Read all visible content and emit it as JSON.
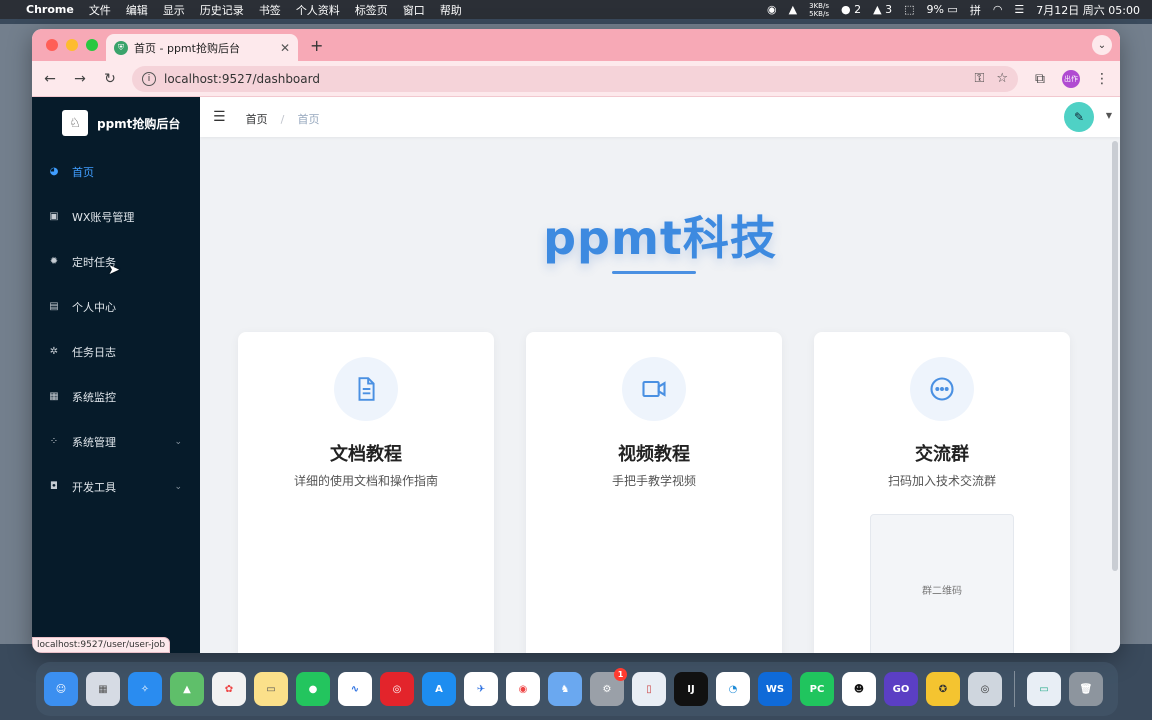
{
  "menubar": {
    "app_name": "Chrome",
    "items": [
      "文件",
      "编辑",
      "显示",
      "历史记录",
      "书签",
      "个人资料",
      "标签页",
      "窗口",
      "帮助"
    ],
    "net_up": "3KB/s",
    "net_down": "5KB/s",
    "wechat_count": "2",
    "notify_count": "3",
    "battery": "9%",
    "ime": "拼",
    "datetime": "7月12日 周六  05:00"
  },
  "browser": {
    "tab_title": "首页 - ppmt抢购后台",
    "url": "localhost:9527/dashboard",
    "profile_label": "出作",
    "status_url": "localhost:9527/user/user-job"
  },
  "sidebar": {
    "logo_text": "ppmt抢购后台",
    "items": [
      {
        "label": "首页",
        "icon": "dashboard-icon"
      },
      {
        "label": "WX账号管理",
        "icon": "wechat-icon"
      },
      {
        "label": "定时任务",
        "icon": "gear-icon"
      },
      {
        "label": "个人中心",
        "icon": "user-card-icon"
      },
      {
        "label": "任务日志",
        "icon": "bug-icon"
      },
      {
        "label": "系统监控",
        "icon": "monitor-icon"
      },
      {
        "label": "系统管理",
        "icon": "grid-icon"
      },
      {
        "label": "开发工具",
        "icon": "tool-icon"
      }
    ]
  },
  "navbar": {
    "breadcrumb": [
      "首页",
      "首页"
    ]
  },
  "hero": {
    "title": "ppmt科技"
  },
  "cards": [
    {
      "title": "文档教程",
      "desc": "详细的使用文档和操作指南",
      "icon": "document-icon"
    },
    {
      "title": "视频教程",
      "desc": "手把手教学视频",
      "icon": "video-icon"
    },
    {
      "title": "交流群",
      "desc": "扫码加入技术交流群",
      "icon": "chat-icon",
      "qr_label": "群二维码"
    }
  ],
  "dock": {
    "settings_badge": "1",
    "apps": [
      "finder",
      "launchpad",
      "safari",
      "maps",
      "photos",
      "notes",
      "wechat",
      "freeform",
      "netease-music",
      "app-store",
      "lark",
      "chrome",
      "qq-cat",
      "system-settings",
      "phone-mirror",
      "intellij",
      "edge",
      "webstorm",
      "pycharm",
      "qq",
      "goland",
      "xiaomi",
      "quicktime",
      "preview",
      "trash"
    ]
  }
}
